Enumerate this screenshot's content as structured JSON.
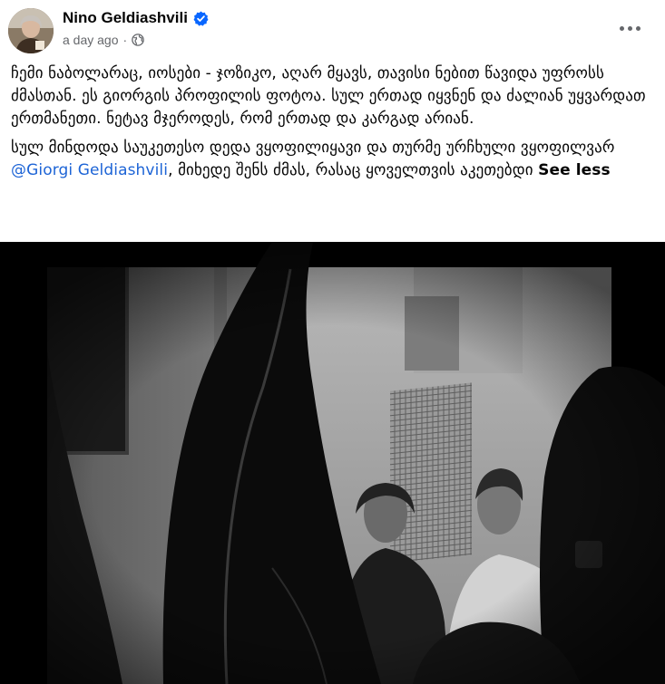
{
  "post": {
    "author": "Nino Geldiashvili",
    "timestamp": "a day ago",
    "separator": "·",
    "verified": true,
    "paragraph1": "ჩემი ნაბოლარაც, იოსები - ჯოზიკო, აღარ მყავს, თავისი ნებით წავიდა უფროსს ძმასთან. ეს გიორგის პროფილის ფოტოა. სულ ერთად იყვნენ და ძალიან უყვარდათ ერთმანეთი. ნეტავ მჯეროდეს, რომ ერთად და კარგად არიან.",
    "paragraph2_line1": "სულ მინდოდა საუკეთესო დედა ვყოფილიყავი და თურმე ურჩხული ვყოფილვარ",
    "mention": "@Giorgi Geldiashvili",
    "paragraph2_rest": ", მიხედე შენს ძმას, რასაც ყოველთვის აკეთებდი",
    "see_less": "See less"
  },
  "colors": {
    "verified_badge": "#0866ff",
    "mention": "#1d64d6",
    "meta": "#65676b"
  },
  "icons": {
    "verified": "verified-badge-icon",
    "privacy": "globe-icon",
    "menu": "more-options-icon"
  }
}
